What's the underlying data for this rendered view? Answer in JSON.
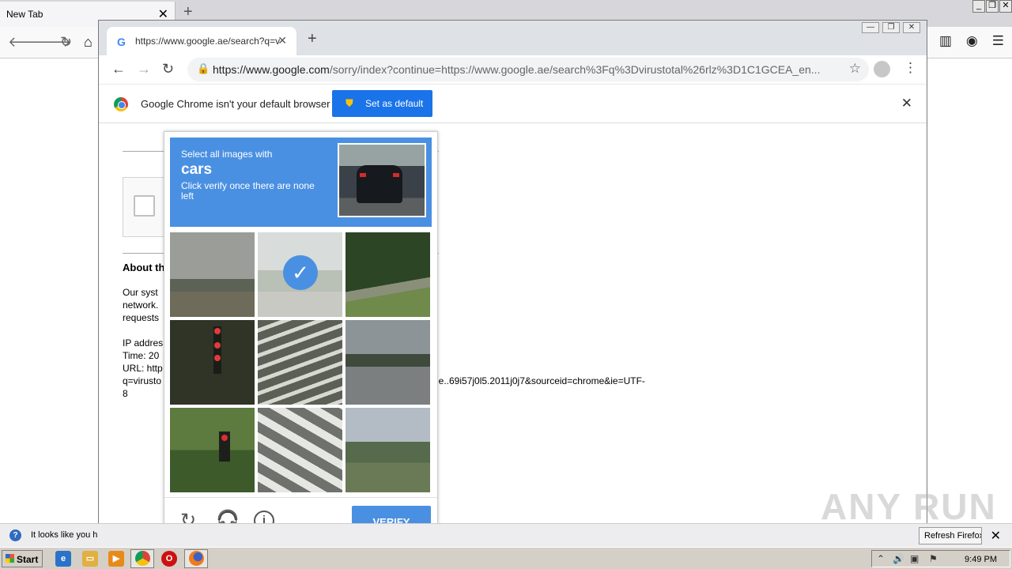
{
  "firefox": {
    "tab_title": "New Tab",
    "notification_text": "It looks like you h",
    "notification_button": "Refresh Firefox..."
  },
  "chrome": {
    "tab_title": "https://www.google.ae/search?q=v",
    "url_host": "https://www.google.com",
    "url_path": "/sorry/index?continue=https://www.google.ae/search%3Fq%3Dvirustotal%26rlz%3D1C1GCEA_en...",
    "infobar": {
      "message": "Google Chrome isn't your default browser",
      "button": "Set as default"
    }
  },
  "page": {
    "about_heading": "About th",
    "lines": [
      "Our syst",
      "network.",
      "requests",
      "IP addres",
      "Time: 20",
      "URL: http",
      "q=virusto",
      "8"
    ],
    "url_tail": "ome..69i57j0l5.2011j0j7&sourceid=chrome&ie=UTF-"
  },
  "captcha": {
    "instruction": "Select all images with",
    "target": "cars",
    "hint": "Click verify once there are none left",
    "verify_label": "VERIFY",
    "tiles": [
      {
        "name": "tile-bridge",
        "selected": false
      },
      {
        "name": "tile-road-selected",
        "selected": true
      },
      {
        "name": "tile-trees-guardrail",
        "selected": false
      },
      {
        "name": "tile-traffic-light",
        "selected": false
      },
      {
        "name": "tile-crosswalk",
        "selected": false
      },
      {
        "name": "tile-highway",
        "selected": false
      },
      {
        "name": "tile-traffic-light-trees",
        "selected": false
      },
      {
        "name": "tile-crosswalk-stripes",
        "selected": false
      },
      {
        "name": "tile-palm-trees",
        "selected": false
      }
    ]
  },
  "watermark": "ANY RUN",
  "taskbar": {
    "start_label": "Start",
    "clock": "9:49 PM"
  }
}
